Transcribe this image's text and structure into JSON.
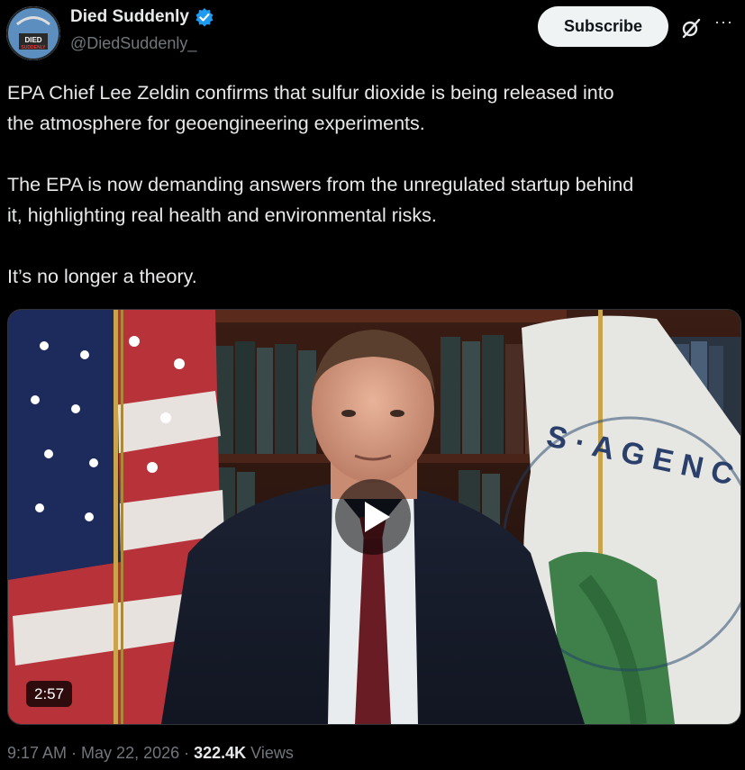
{
  "author": {
    "display_name": "Died Suddenly",
    "handle": "@DiedSuddenly_",
    "avatar_text_top": "DIED",
    "avatar_text_bottom": "SUDDENLY",
    "verified_color": "#1d9bf0"
  },
  "actions": {
    "subscribe_label": "Subscribe",
    "grok_icon": "grok-slash-icon",
    "more_icon": "more-dots-icon",
    "more_label": "···"
  },
  "tweet": {
    "paragraph_1_line_1": "EPA Chief Lee Zeldin confirms that sulfur dioxide is being released into",
    "paragraph_1_line_2": "the atmosphere for geoengineering experiments.",
    "paragraph_2_line_1": "The EPA is now demanding answers from the unregulated startup behind",
    "paragraph_2_line_2": "it, highlighting real health and environmental risks.",
    "paragraph_3": "It’s no longer a theory."
  },
  "media": {
    "duration": "2:57",
    "play_icon": "play-icon",
    "flag_text": "S · A G E N C"
  },
  "meta": {
    "time": "9:17 AM",
    "separator": "·",
    "date": "May 22, 2026",
    "views_count": "322.4K",
    "views_label": "Views"
  },
  "colors": {
    "background": "#000000",
    "text_primary": "#e7e9ea",
    "text_secondary": "#71767b",
    "button_bg": "#eff3f4"
  }
}
